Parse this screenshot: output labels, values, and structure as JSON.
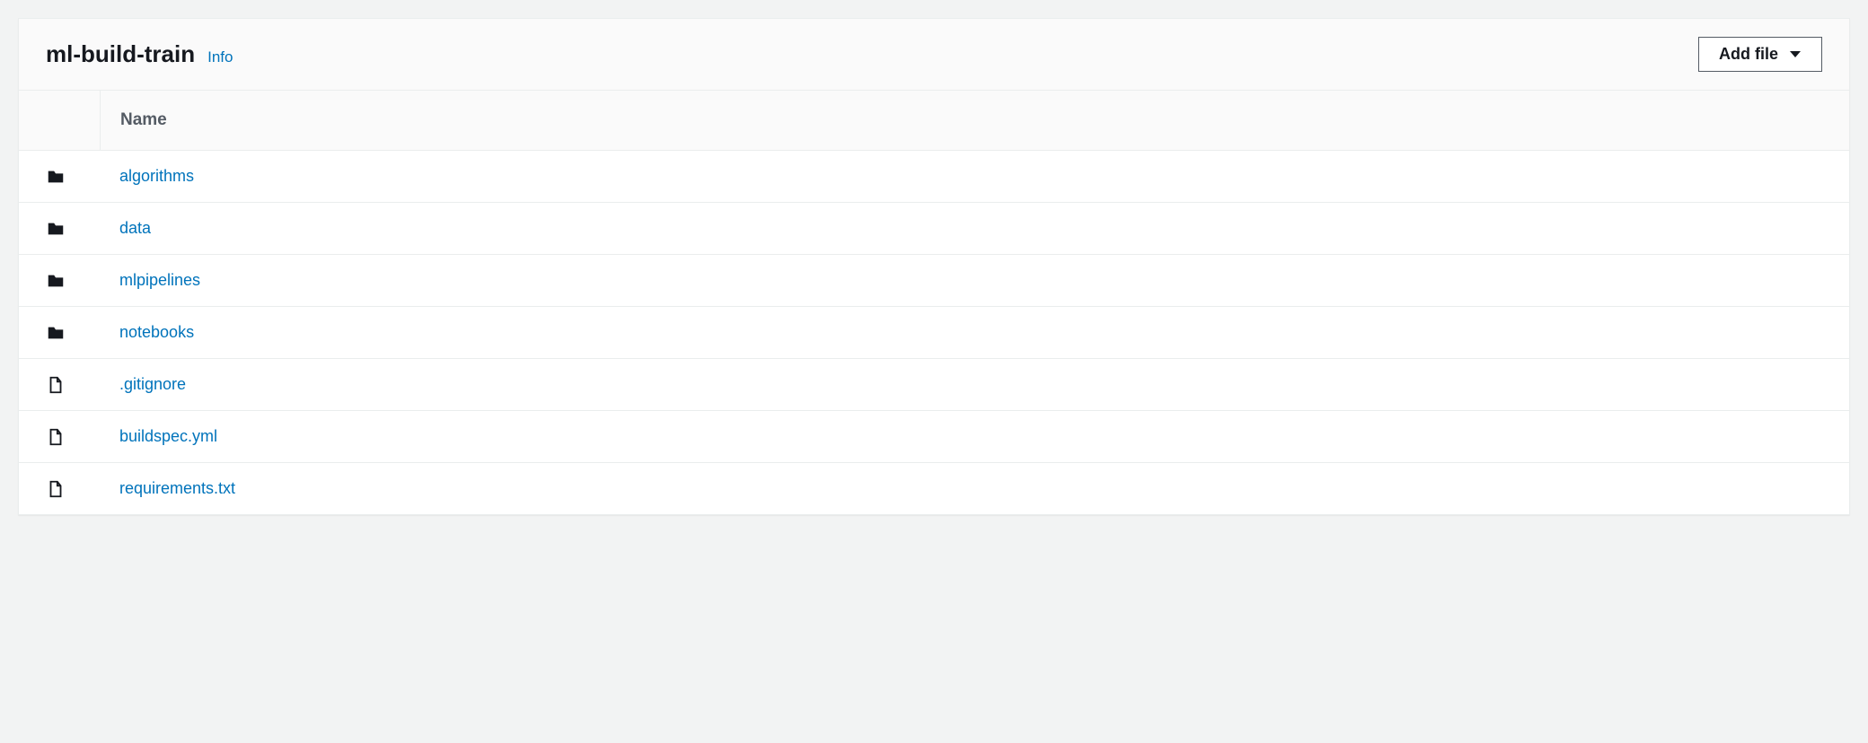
{
  "header": {
    "title": "ml-build-train",
    "info_label": "Info",
    "add_file_label": "Add file"
  },
  "table": {
    "name_header": "Name",
    "items": [
      {
        "type": "folder",
        "name": "algorithms"
      },
      {
        "type": "folder",
        "name": "data"
      },
      {
        "type": "folder",
        "name": "mlpipelines"
      },
      {
        "type": "folder",
        "name": "notebooks"
      },
      {
        "type": "file",
        "name": ".gitignore"
      },
      {
        "type": "file",
        "name": "buildspec.yml"
      },
      {
        "type": "file",
        "name": "requirements.txt"
      }
    ]
  }
}
